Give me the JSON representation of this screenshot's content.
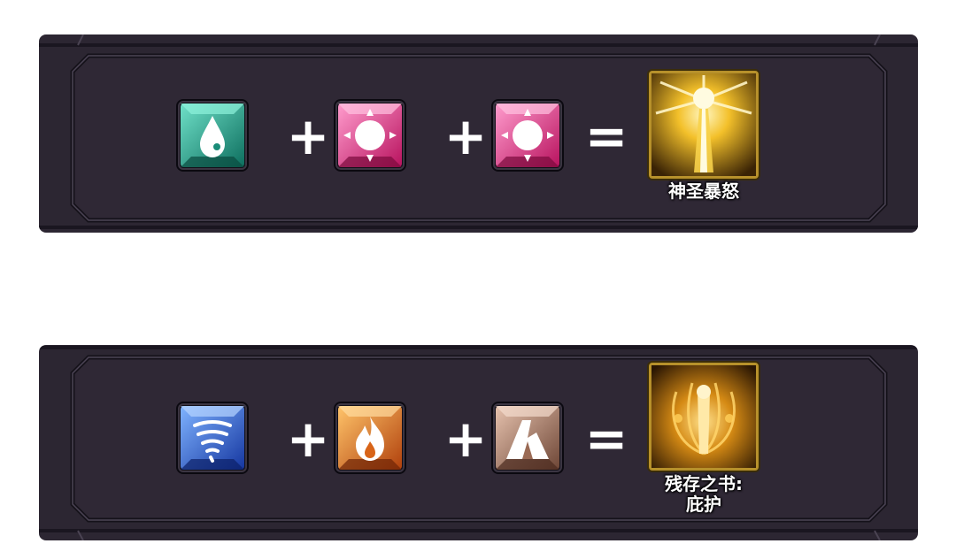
{
  "recipes": [
    {
      "ingredients": [
        {
          "icon": "water-drop-gem-icon",
          "color": "#1fa58f"
        },
        {
          "icon": "sun-gem-icon",
          "color": "#e8348a"
        },
        {
          "icon": "sun-gem-icon",
          "color": "#e8348a"
        }
      ],
      "operators": [
        "+",
        "+",
        "="
      ],
      "result": {
        "name": "神圣暴怒",
        "name_line2": "",
        "icon": "holy-wrath-skill-icon",
        "color": "#e8b21f"
      }
    },
    {
      "ingredients": [
        {
          "icon": "tornado-gem-icon",
          "color": "#2d63d8"
        },
        {
          "icon": "fire-gem-icon",
          "color": "#e0731a"
        },
        {
          "icon": "rock-gem-icon",
          "color": "#b5846c"
        }
      ],
      "operators": [
        "+",
        "+",
        "="
      ],
      "result": {
        "name": "残存之书:",
        "name_line2": "庇护",
        "icon": "book-of-remnants-skill-icon",
        "color": "#d99a1f"
      }
    }
  ]
}
